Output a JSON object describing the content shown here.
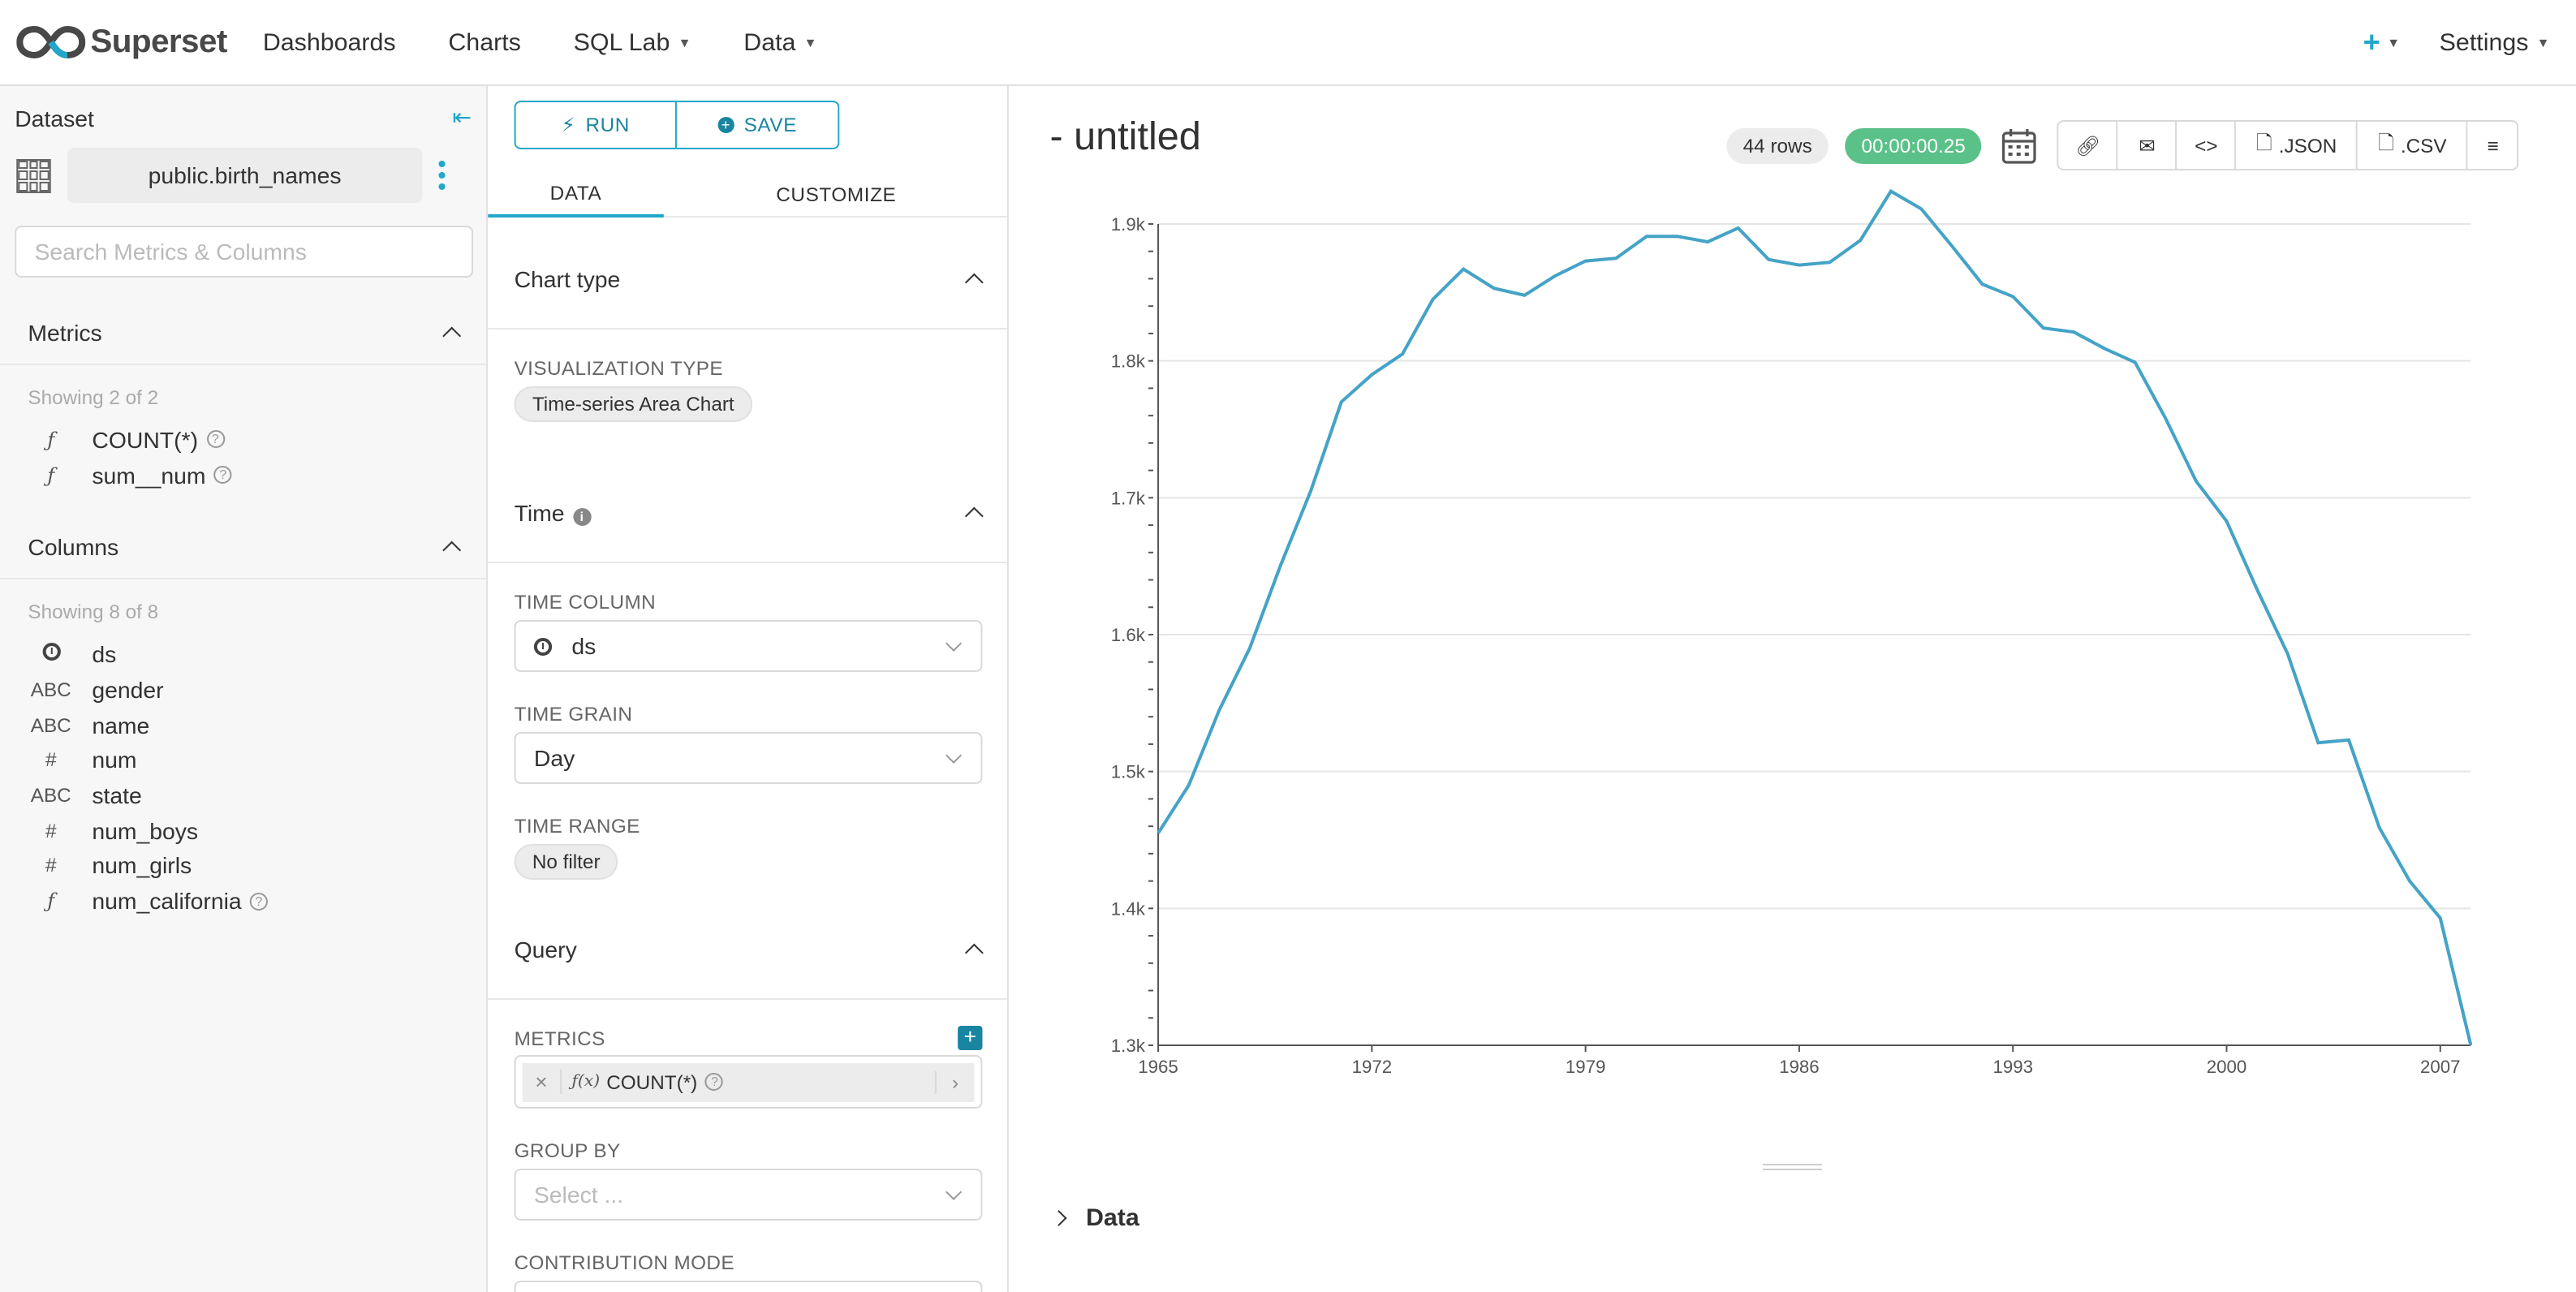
{
  "nav": {
    "brand": "Superset",
    "items": [
      {
        "label": "Dashboards",
        "caret": false
      },
      {
        "label": "Charts",
        "caret": false
      },
      {
        "label": "SQL Lab",
        "caret": true
      },
      {
        "label": "Data",
        "caret": true
      }
    ],
    "plus": "+",
    "settings": "Settings"
  },
  "dataset": {
    "title": "Dataset",
    "name": "public.birth_names",
    "search_placeholder": "Search Metrics & Columns",
    "metrics": {
      "title": "Metrics",
      "showing": "Showing 2 of 2",
      "items": [
        {
          "type": "ƒ",
          "name": "COUNT(*)",
          "help": true
        },
        {
          "type": "ƒ",
          "name": "sum__num",
          "help": true
        }
      ]
    },
    "columns": {
      "title": "Columns",
      "showing": "Showing 8 of 8",
      "items": [
        {
          "type": "clock",
          "name": "ds",
          "help": false
        },
        {
          "type": "ABC",
          "name": "gender",
          "help": false
        },
        {
          "type": "ABC",
          "name": "name",
          "help": false
        },
        {
          "type": "#",
          "name": "num",
          "help": false
        },
        {
          "type": "ABC",
          "name": "state",
          "help": false
        },
        {
          "type": "#",
          "name": "num_boys",
          "help": false
        },
        {
          "type": "#",
          "name": "num_girls",
          "help": false
        },
        {
          "type": "ƒ",
          "name": "num_california",
          "help": true
        }
      ]
    }
  },
  "controls": {
    "run": "RUN",
    "save": "SAVE",
    "tab_data": "DATA",
    "tab_customize": "CUSTOMIZE",
    "chart_type": {
      "title": "Chart type",
      "viz_label": "VISUALIZATION TYPE",
      "viz_value": "Time-series Area Chart"
    },
    "time": {
      "title": "Time",
      "column_label": "TIME COLUMN",
      "column_value": "ds",
      "grain_label": "TIME GRAIN",
      "grain_value": "Day",
      "range_label": "TIME RANGE",
      "range_value": "No filter"
    },
    "query": {
      "title": "Query",
      "metrics_label": "METRICS",
      "metric_chip": "COUNT(*)",
      "metric_fx": "ƒ(x)",
      "groupby_label": "GROUP BY",
      "groupby_placeholder": "Select ...",
      "contribution_label": "CONTRIBUTION MODE"
    }
  },
  "chart_header": {
    "title": "- untitled",
    "rows": "44 rows",
    "time": "00:00:00.25",
    "json": ".JSON",
    "csv": ".CSV"
  },
  "data_section": "Data",
  "colors": {
    "accent": "#20a7c9",
    "line": "#44a3c6",
    "success": "#5ac189"
  },
  "chart_data": {
    "type": "line",
    "x": [
      1965,
      1966,
      1967,
      1968,
      1969,
      1970,
      1971,
      1972,
      1973,
      1974,
      1975,
      1976,
      1977,
      1978,
      1979,
      1980,
      1981,
      1982,
      1983,
      1984,
      1985,
      1986,
      1987,
      1988,
      1989,
      1990,
      1991,
      1992,
      1993,
      1994,
      1995,
      1996,
      1997,
      1998,
      1999,
      2000,
      2001,
      2002,
      2003,
      2004,
      2005,
      2006,
      2007,
      2008
    ],
    "series": [
      {
        "values": [
          1455,
          1490,
          1545,
          1590,
          1650,
          1705,
          1770,
          1790,
          1805,
          1845,
          1867,
          1853,
          1848,
          1862,
          1873,
          1875,
          1891,
          1891,
          1887,
          1897,
          1874,
          1870,
          1872,
          1888,
          1924,
          1911,
          1884,
          1856,
          1847,
          1824,
          1821,
          1809,
          1799,
          1758,
          1712,
          1683,
          1633,
          1586,
          1521,
          1523,
          1459,
          1420,
          1393,
          1300
        ]
      }
    ],
    "xticks": [
      "1965",
      "1972",
      "1979",
      "1986",
      "1993",
      "2000",
      "2007"
    ],
    "yticks": [
      "1.3k",
      "1.4k",
      "1.5k",
      "1.6k",
      "1.7k",
      "1.8k",
      "1.9k"
    ],
    "ylim": [
      1300,
      1900
    ],
    "xlim": [
      1965,
      2008
    ],
    "grid": true
  }
}
